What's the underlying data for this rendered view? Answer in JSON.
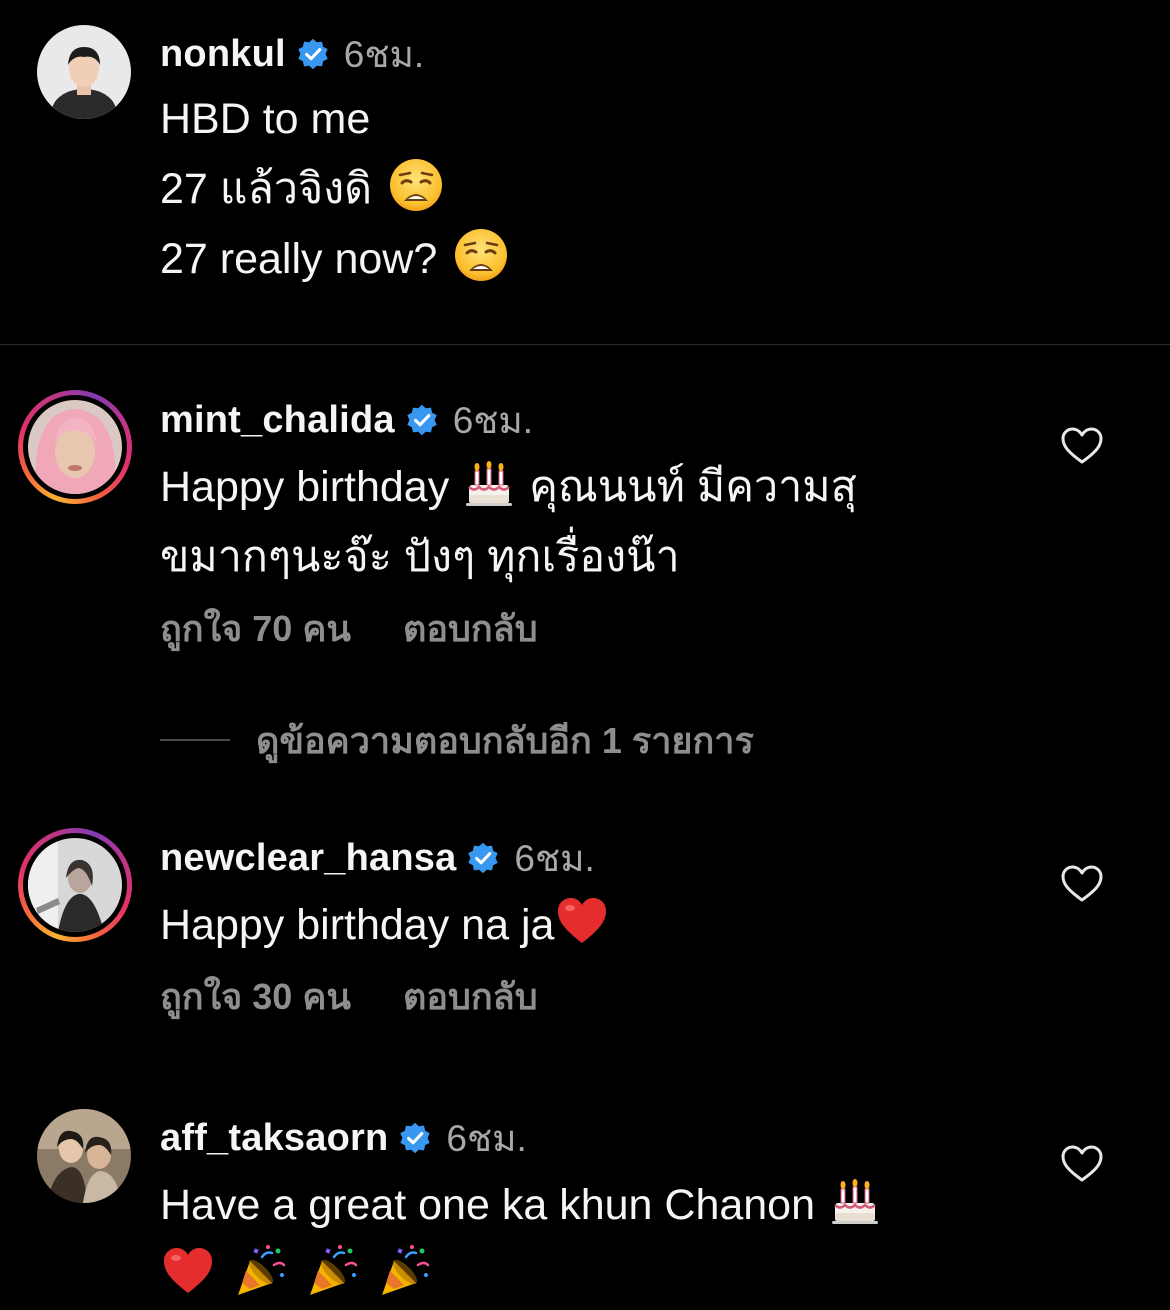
{
  "colors": {
    "background": "#000000",
    "text": "#f5f5f5",
    "muted": "#8e8e8e",
    "verified": "#3897f0",
    "story_ring": [
      "#f9b233",
      "#e1306c",
      "#833ab4"
    ]
  },
  "caption": {
    "username": "nonkul",
    "verified_icon": "verified-badge-icon",
    "time": "6ชม.",
    "lines": [
      {
        "text": "HBD to me",
        "emoji": ""
      },
      {
        "text": "27 แล้วจิงดิ ",
        "emoji": "weary-face-emoji"
      },
      {
        "text": "27 really now? ",
        "emoji": "weary-face-emoji"
      }
    ]
  },
  "comments": [
    {
      "username": "mint_chalida",
      "time": "6ชม.",
      "line1": "Happy birthday ",
      "line1_emoji": "birthday-cake-emoji",
      "line1_rest": " คุณนนท์ มีความสุ",
      "line2": "ขมากๆนะจ๊ะ ปังๆ ทุกเรื่องน๊า",
      "likes": "ถูกใจ 70 คน",
      "reply": "ตอบกลับ",
      "heart_icon": "heart-outline-icon"
    },
    {
      "username": "newclear_hansa",
      "time": "6ชม.",
      "line1": "Happy birthday na ja",
      "line1_emoji": "red-heart-emoji",
      "likes": "ถูกใจ 30 คน",
      "reply": "ตอบกลับ",
      "heart_icon": "heart-outline-icon"
    },
    {
      "username": "aff_taksaorn",
      "time": "6ชม.",
      "line1": "Have a great one ka khun Chanon ",
      "line1_emoji": "birthday-cake-emoji",
      "line2_emojis": [
        "red-heart-emoji",
        "party-popper-emoji",
        "party-popper-emoji",
        "party-popper-emoji"
      ],
      "heart_icon": "heart-outline-icon"
    }
  ],
  "view_replies": "ดูข้อความตอบกลับอีก 1 รายการ"
}
